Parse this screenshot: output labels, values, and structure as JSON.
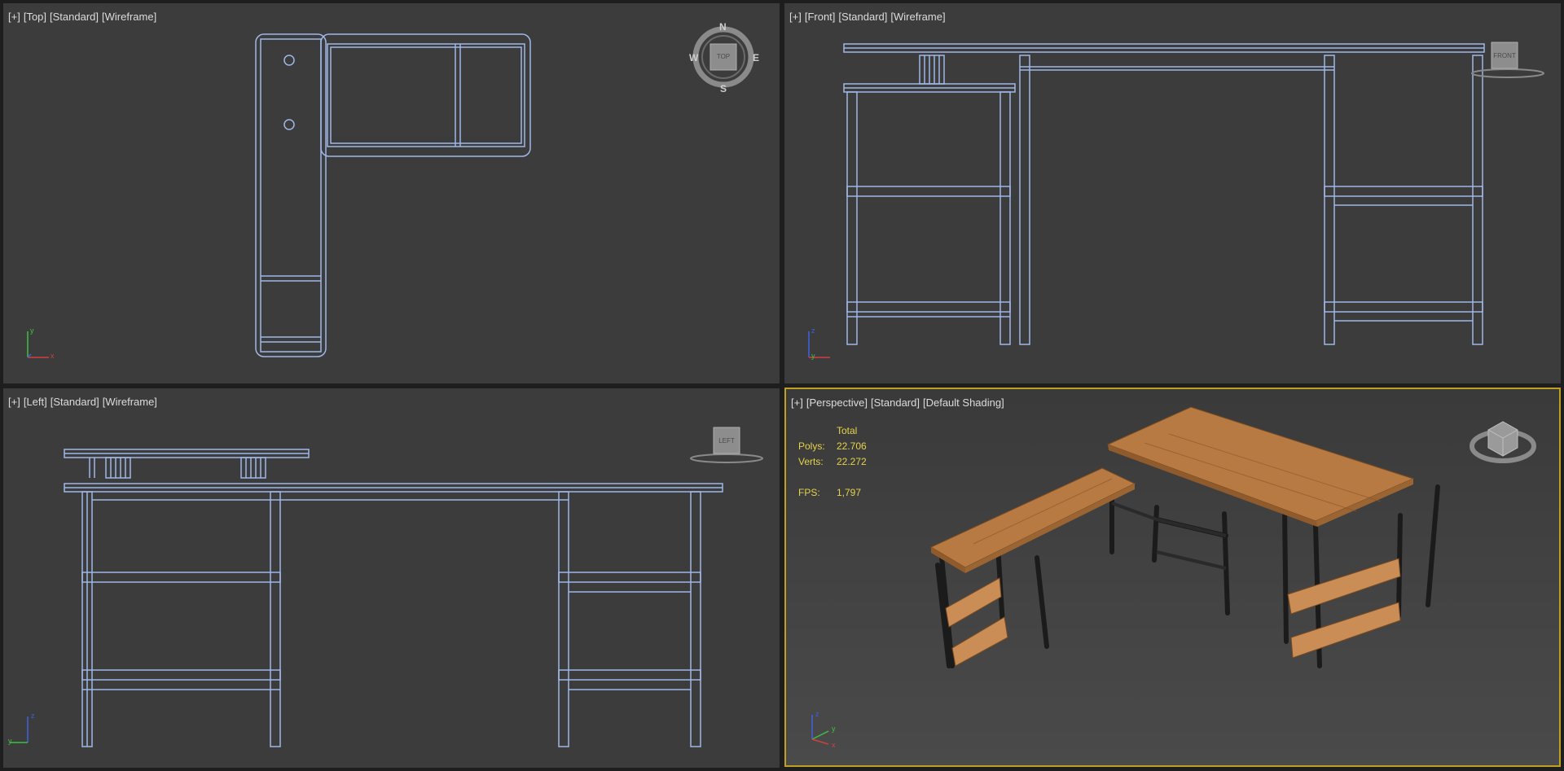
{
  "viewports": {
    "top": {
      "label": [
        "[+]",
        "[Top]",
        "[Standard]",
        "[Wireframe]"
      ],
      "compass": [
        "N",
        "S",
        "W",
        "E"
      ],
      "cube": "TOP"
    },
    "front": {
      "label": [
        "[+]",
        "[Front]",
        "[Standard]",
        "[Wireframe]"
      ],
      "cube": "FRONT"
    },
    "left": {
      "label": [
        "[+]",
        "[Left]",
        "[Standard]",
        "[Wireframe]"
      ],
      "cube": "LEFT"
    },
    "perspective": {
      "label": [
        "[+]",
        "[Perspective]",
        "[Standard]",
        "[Default Shading]"
      ]
    }
  },
  "stats": {
    "total_label": "Total",
    "polys_label": "Polys:",
    "polys": "22.706",
    "verts_label": "Verts:",
    "verts": "22.272",
    "fps_label": "FPS:",
    "fps": "1,797"
  },
  "axes": {
    "x": "x",
    "y": "y",
    "z": "z"
  },
  "colors": {
    "wire": "#9fb8e8",
    "active_border": "#c0a020",
    "stats_text": "#e6d34a",
    "wood": "#b97a43",
    "metal": "#222222"
  }
}
